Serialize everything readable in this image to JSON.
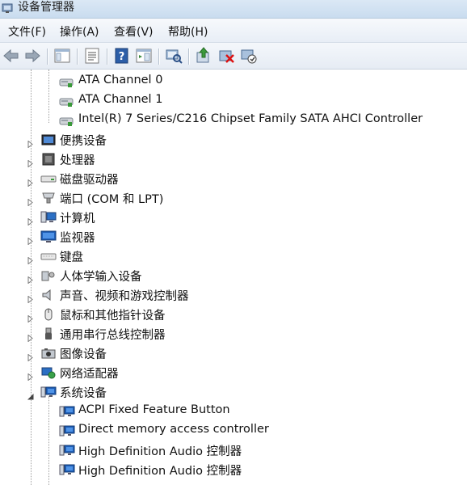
{
  "window": {
    "title": "设备管理器"
  },
  "menu": [
    "文件(F)",
    "操作(A)",
    "查看(V)",
    "帮助(H)"
  ],
  "toolbar": {
    "buttons": [
      "back-icon",
      "forward-icon",
      "show-hide-console-tree-icon",
      "properties-icon",
      "help-icon",
      "action-pane-icon",
      "scan-hardware-changes-icon",
      "update-driver-icon",
      "uninstall-device-icon",
      "disable-device-icon"
    ]
  },
  "tree": {
    "items": [
      {
        "label": "ATA Channel 0",
        "icon": "ide-channel-icon",
        "expander": "none",
        "level": 2
      },
      {
        "label": "ATA Channel 1",
        "icon": "ide-channel-icon",
        "expander": "none",
        "level": 2
      },
      {
        "label": "Intel(R) 7 Series/C216 Chipset Family SATA AHCI Controller",
        "icon": "ide-channel-icon",
        "expander": "none",
        "level": 2
      },
      {
        "label": "便携设备",
        "icon": "portable-device-icon",
        "expander": "collapsed",
        "level": 1
      },
      {
        "label": "处理器",
        "icon": "processor-icon",
        "expander": "collapsed",
        "level": 1
      },
      {
        "label": "磁盘驱动器",
        "icon": "disk-drive-icon",
        "expander": "collapsed",
        "level": 1
      },
      {
        "label": "端口 (COM 和 LPT)",
        "icon": "port-icon",
        "expander": "collapsed",
        "level": 1
      },
      {
        "label": "计算机",
        "icon": "computer-icon",
        "expander": "collapsed",
        "level": 1
      },
      {
        "label": "监视器",
        "icon": "monitor-icon",
        "expander": "collapsed",
        "level": 1
      },
      {
        "label": "键盘",
        "icon": "keyboard-icon",
        "expander": "collapsed",
        "level": 1
      },
      {
        "label": "人体学输入设备",
        "icon": "hid-icon",
        "expander": "collapsed",
        "level": 1
      },
      {
        "label": "声音、视频和游戏控制器",
        "icon": "sound-icon",
        "expander": "collapsed",
        "level": 1
      },
      {
        "label": "鼠标和其他指针设备",
        "icon": "mouse-icon",
        "expander": "collapsed",
        "level": 1
      },
      {
        "label": "通用串行总线控制器",
        "icon": "usb-icon",
        "expander": "collapsed",
        "level": 1
      },
      {
        "label": "图像设备",
        "icon": "imaging-device-icon",
        "expander": "collapsed",
        "level": 1
      },
      {
        "label": "网络适配器",
        "icon": "network-adapter-icon",
        "expander": "collapsed",
        "level": 1
      },
      {
        "label": "系统设备",
        "icon": "system-device-icon",
        "expander": "expanded",
        "level": 1
      },
      {
        "label": "ACPI Fixed Feature Button",
        "icon": "system-device-icon",
        "expander": "none",
        "level": 2
      },
      {
        "label": "Direct memory access controller",
        "icon": "system-device-icon",
        "expander": "none",
        "level": 2
      },
      {
        "label": "High Definition Audio 控制器",
        "icon": "system-device-icon",
        "expander": "none",
        "level": 2
      },
      {
        "label": "High Definition Audio 控制器",
        "icon": "system-device-icon",
        "expander": "none",
        "level": 2
      }
    ]
  }
}
